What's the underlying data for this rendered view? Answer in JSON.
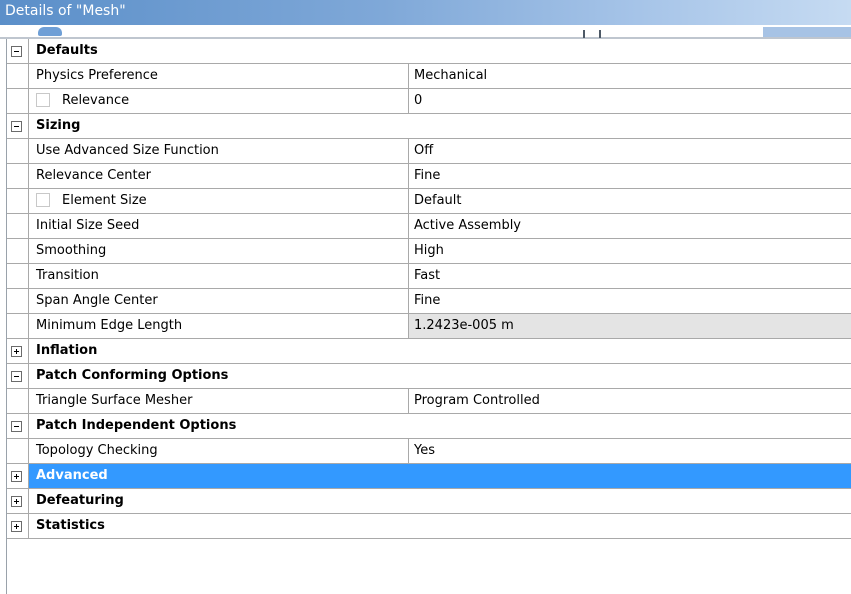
{
  "window": {
    "title": "Details of \"Mesh\""
  },
  "groups": {
    "defaults": {
      "label": "Defaults",
      "expanded": true,
      "rows": {
        "physics_preference": {
          "label": "Physics Preference",
          "value": "Mechanical"
        },
        "relevance": {
          "label": "Relevance",
          "value": "0",
          "checkbox": false
        }
      }
    },
    "sizing": {
      "label": "Sizing",
      "expanded": true,
      "rows": {
        "use_advanced_size_function": {
          "label": "Use Advanced Size Function",
          "value": "Off"
        },
        "relevance_center": {
          "label": "Relevance Center",
          "value": "Fine"
        },
        "element_size": {
          "label": "Element Size",
          "value": "Default",
          "checkbox": false
        },
        "initial_size_seed": {
          "label": "Initial Size Seed",
          "value": "Active Assembly"
        },
        "smoothing": {
          "label": "Smoothing",
          "value": "High"
        },
        "transition": {
          "label": "Transition",
          "value": "Fast"
        },
        "span_angle_center": {
          "label": "Span Angle Center",
          "value": "Fine"
        },
        "minimum_edge_length": {
          "label": "Minimum Edge Length",
          "value": "1.2423e-005 m",
          "readonly": true
        }
      }
    },
    "inflation": {
      "label": "Inflation",
      "expanded": false
    },
    "patch_conforming_options": {
      "label": "Patch Conforming Options",
      "expanded": true,
      "rows": {
        "triangle_surface_mesher": {
          "label": "Triangle Surface Mesher",
          "value": "Program Controlled"
        }
      }
    },
    "patch_independent_options": {
      "label": "Patch Independent Options",
      "expanded": true,
      "rows": {
        "topology_checking": {
          "label": "Topology Checking",
          "value": "Yes"
        }
      }
    },
    "advanced": {
      "label": "Advanced",
      "expanded": false,
      "selected": true
    },
    "defeaturing": {
      "label": "Defeaturing",
      "expanded": false
    },
    "statistics": {
      "label": "Statistics",
      "expanded": false
    }
  },
  "icons": {
    "collapse": "minus-box-icon",
    "expand": "plus-box-icon"
  },
  "colors": {
    "title_bar": "#5b8fc9",
    "selection": "#3399ff",
    "grid_line": "#a9a9a9",
    "readonly_cell": "#e4e4e4"
  }
}
